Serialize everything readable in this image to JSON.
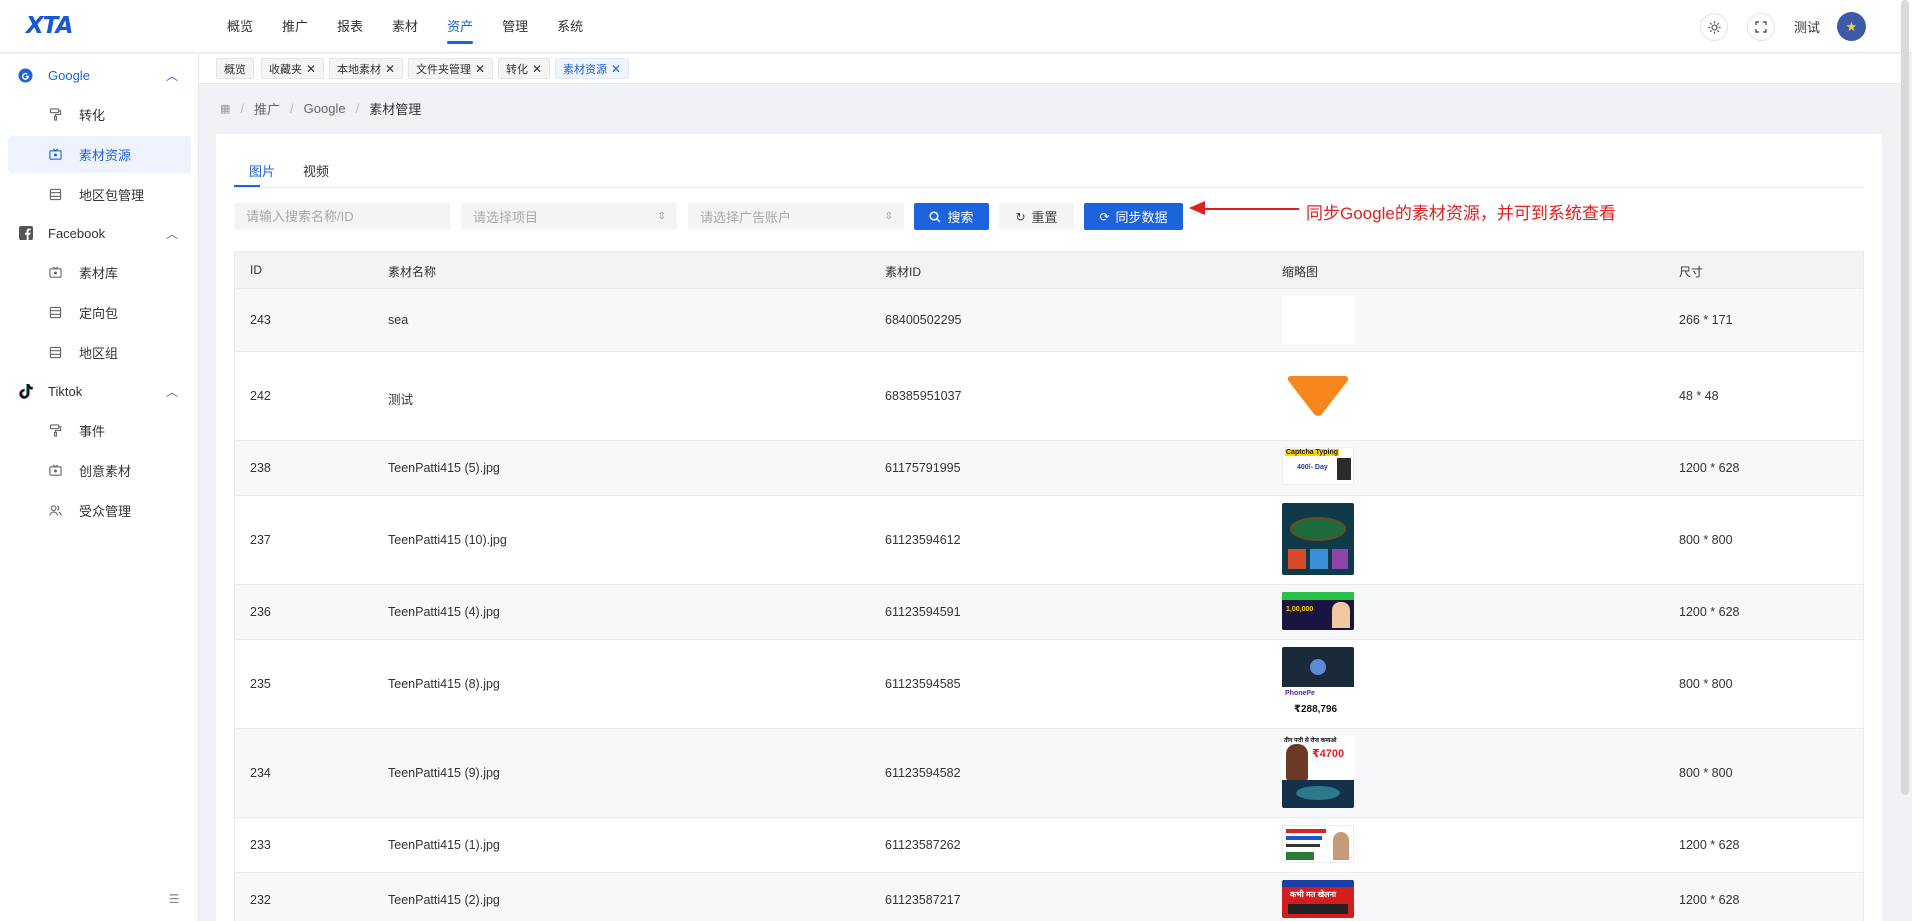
{
  "app": {
    "logo": "XTA"
  },
  "topnav": [
    {
      "label": "概览",
      "active": false
    },
    {
      "label": "推广",
      "active": false
    },
    {
      "label": "报表",
      "active": false
    },
    {
      "label": "素材",
      "active": false
    },
    {
      "label": "资产",
      "active": true
    },
    {
      "label": "管理",
      "active": false
    },
    {
      "label": "系统",
      "active": false
    }
  ],
  "header": {
    "user_name": "测试",
    "theme_icon": "sun-icon",
    "fullscreen_icon": "fullscreen-icon"
  },
  "sidebar": {
    "groups": [
      {
        "label": "Google",
        "icon": "google-icon",
        "expanded": true,
        "color": "#1c63e0",
        "items": [
          {
            "label": "转化",
            "icon": "paint-roller-icon",
            "active": false
          },
          {
            "label": "素材资源",
            "icon": "tv-icon",
            "active": true
          },
          {
            "label": "地区包管理",
            "icon": "list-icon",
            "active": false
          }
        ]
      },
      {
        "label": "Facebook",
        "icon": "facebook-icon",
        "expanded": true,
        "color": "#333333",
        "items": [
          {
            "label": "素材库",
            "icon": "tv-icon",
            "active": false
          },
          {
            "label": "定向包",
            "icon": "list-icon",
            "active": false
          },
          {
            "label": "地区组",
            "icon": "list-icon",
            "active": false
          }
        ]
      },
      {
        "label": "Tiktok",
        "icon": "tiktok-icon",
        "expanded": true,
        "color": "#333333",
        "items": [
          {
            "label": "事件",
            "icon": "paint-roller-icon",
            "active": false
          },
          {
            "label": "创意素材",
            "icon": "tv-icon",
            "active": false
          },
          {
            "label": "受众管理",
            "icon": "users-icon",
            "active": false
          }
        ]
      }
    ]
  },
  "tags": [
    {
      "label": "概览",
      "closable": false,
      "active": false
    },
    {
      "label": "收藏夹",
      "closable": true,
      "active": false
    },
    {
      "label": "本地素材",
      "closable": true,
      "active": false
    },
    {
      "label": "文件夹管理",
      "closable": true,
      "active": false
    },
    {
      "label": "转化",
      "closable": true,
      "active": false
    },
    {
      "label": "素材资源",
      "closable": true,
      "active": true
    }
  ],
  "breadcrumb": [
    "推广",
    "Google",
    "素材管理"
  ],
  "content_tabs": [
    {
      "label": "图片",
      "active": true
    },
    {
      "label": "视频",
      "active": false
    }
  ],
  "filters": {
    "search_placeholder": "请输入搜索名称/ID",
    "project_placeholder": "请选择项目",
    "account_placeholder": "请选择广告账户"
  },
  "buttons": {
    "search": "搜索",
    "reset": "重置",
    "sync": "同步数据"
  },
  "annotation": "同步Google的素材资源，并可到系统查看",
  "table": {
    "columns": [
      "ID",
      "素材名称",
      "素材ID",
      "缩略图",
      "尺寸"
    ],
    "rows": [
      {
        "id": "243",
        "name": "sea",
        "asset_id": "68400502295",
        "thumb": "blank",
        "size": "266 * 171"
      },
      {
        "id": "242",
        "name": "测试",
        "asset_id": "68385951037",
        "thumb": "triangle",
        "size": "48 * 48"
      },
      {
        "id": "238",
        "name": "TeenPatti415 (5).jpg",
        "asset_id": "61175791995",
        "thumb": "banner",
        "size": "1200 * 628"
      },
      {
        "id": "237",
        "name": "TeenPatti415 (10).jpg",
        "asset_id": "61123594612",
        "thumb": "game",
        "size": "800 * 800"
      },
      {
        "id": "236",
        "name": "TeenPatti415 (4).jpg",
        "asset_id": "61123594591",
        "thumb": "promo",
        "size": "1200 * 628"
      },
      {
        "id": "235",
        "name": "TeenPatti415 (8).jpg",
        "asset_id": "61123594585",
        "thumb": "phonepe",
        "size": "800 * 800"
      },
      {
        "id": "234",
        "name": "TeenPatti415 (9).jpg",
        "asset_id": "61123594582",
        "thumb": "woman",
        "size": "800 * 800"
      },
      {
        "id": "233",
        "name": "TeenPatti415 (1).jpg",
        "asset_id": "61123587262",
        "thumb": "person",
        "size": "1200 * 628"
      },
      {
        "id": "232",
        "name": "TeenPatti415 (2).jpg",
        "asset_id": "61123587217",
        "thumb": "redbanner",
        "size": "1200 * 628"
      }
    ],
    "thumb_texts": {
      "banner_title": "Captcha Typing",
      "banner_amount": "400/- Day",
      "promo_amount": "1,00,000",
      "phonepe_brand": "PhonePe",
      "phonepe_amount": "₹288,796",
      "woman_amount": "₹4700",
      "woman_title": "तीन पत्ती से रोज कमाओ",
      "redbanner_title": "कभी मत खेलना"
    }
  }
}
